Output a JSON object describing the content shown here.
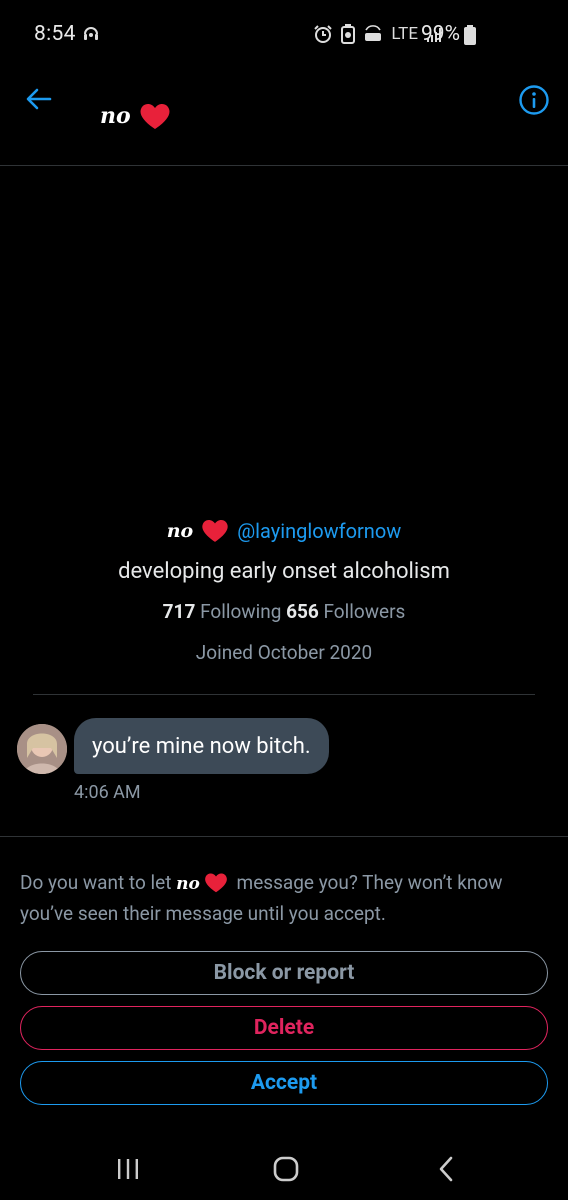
{
  "status_bar": {
    "time": "8:54",
    "network": "LTE",
    "battery": "99%"
  },
  "header": {
    "name": "no",
    "heart": "heart-icon"
  },
  "profile": {
    "name": "no",
    "handle": "@layinglowfornow",
    "bio": "developing early onset alcoholism",
    "following_count": "717",
    "following_label": "Following",
    "followers_count": "656",
    "followers_label": "Followers",
    "joined": "Joined October 2020"
  },
  "message": {
    "text": "you’re mine now bitch.",
    "time": "4:06 AM"
  },
  "request": {
    "prompt_before": "Do you want to let",
    "name": "no",
    "prompt_after": "message you? They won’t know you’ve seen their message until you accept.",
    "block_label": "Block or report",
    "delete_label": "Delete",
    "accept_label": "Accept"
  },
  "colors": {
    "accent": "#1d9bf0",
    "danger": "#e0245e",
    "heart": "#e8213a",
    "background": "#000000"
  }
}
